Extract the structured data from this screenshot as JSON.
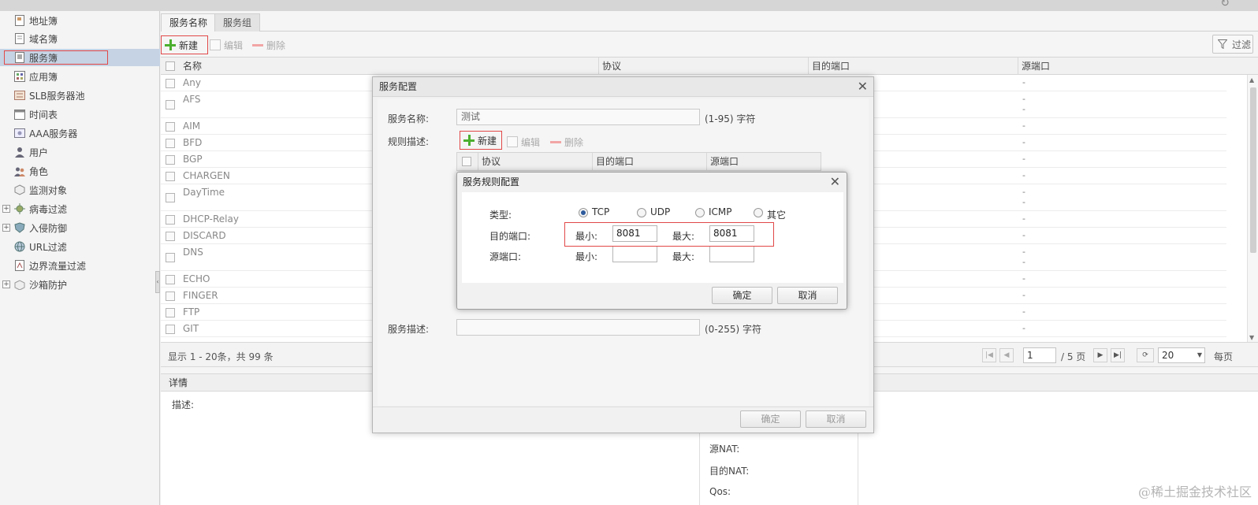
{
  "sidebar": {
    "items": [
      {
        "label": "地址簿",
        "icon": "address-book-icon",
        "expandable": false
      },
      {
        "label": "域名簿",
        "icon": "domain-book-icon",
        "expandable": false
      },
      {
        "label": "服务簿",
        "icon": "service-book-icon",
        "expandable": false,
        "selected": true
      },
      {
        "label": "应用簿",
        "icon": "app-book-icon",
        "expandable": false
      },
      {
        "label": "SLB服务器池",
        "icon": "server-pool-icon",
        "expandable": false
      },
      {
        "label": "时间表",
        "icon": "calendar-icon",
        "expandable": false
      },
      {
        "label": "AAA服务器",
        "icon": "aaa-server-icon",
        "expandable": false
      },
      {
        "label": "用户",
        "icon": "user-icon",
        "expandable": false
      },
      {
        "label": "角色",
        "icon": "role-icon",
        "expandable": false
      },
      {
        "label": "监测对象",
        "icon": "monitor-icon",
        "expandable": false
      },
      {
        "label": "病毒过滤",
        "icon": "virus-filter-icon",
        "expandable": true
      },
      {
        "label": "入侵防御",
        "icon": "shield-icon",
        "expandable": true
      },
      {
        "label": "URL过滤",
        "icon": "globe-icon",
        "expandable": false
      },
      {
        "label": "边界流量过滤",
        "icon": "traffic-filter-icon",
        "expandable": false
      },
      {
        "label": "沙箱防护",
        "icon": "sandbox-icon",
        "expandable": true
      }
    ]
  },
  "tabs": [
    {
      "label": "服务名称",
      "active": true
    },
    {
      "label": "服务组",
      "active": false
    }
  ],
  "toolbar": {
    "new_label": "新建",
    "edit_label": "编辑",
    "delete_label": "删除",
    "filter_label": "过滤"
  },
  "grid": {
    "columns": [
      "名称",
      "协议",
      "目的端口",
      "源端口"
    ],
    "rows": [
      {
        "name": "Any",
        "src": [
          "-"
        ]
      },
      {
        "name": "AFS",
        "src": [
          "-",
          "-"
        ]
      },
      {
        "name": "AIM",
        "src": [
          "-"
        ]
      },
      {
        "name": "BFD",
        "src": [
          "-"
        ]
      },
      {
        "name": "BGP",
        "src": [
          "-"
        ]
      },
      {
        "name": "CHARGEN",
        "src": [
          "-"
        ]
      },
      {
        "name": "DayTime",
        "src": [
          "-",
          "-"
        ]
      },
      {
        "name": "DHCP-Relay",
        "src": [
          "-"
        ]
      },
      {
        "name": "DISCARD",
        "src": [
          "-"
        ]
      },
      {
        "name": "DNS",
        "src": [
          "-",
          "-"
        ]
      },
      {
        "name": "ECHO",
        "src": [
          "-"
        ]
      },
      {
        "name": "FINGER",
        "src": [
          "-"
        ]
      },
      {
        "name": "FTP",
        "src": [
          "-"
        ]
      },
      {
        "name": "GIT",
        "src": [
          "-"
        ]
      }
    ]
  },
  "pager": {
    "info": "显示 1 - 20条，共 99 条",
    "page": "1",
    "total_pages": "/ 5 页",
    "page_size": "20",
    "per_page_label": "每页"
  },
  "detail": {
    "title": "详情",
    "desc_label": "描述:",
    "src_nat_label": "源NAT:",
    "dst_nat_label": "目的NAT:",
    "qos_label": "Qos:"
  },
  "service_dialog": {
    "title": "服务配置",
    "name_label": "服务名称:",
    "name_value": "测试",
    "name_hint": "(1-95) 字符",
    "rule_label": "规则描述:",
    "new_label": "新建",
    "edit_label": "编辑",
    "delete_label": "删除",
    "rule_columns": [
      "协议",
      "目的端口",
      "源端口"
    ],
    "desc_label": "服务描述:",
    "desc_value": "",
    "desc_hint": "(0-255) 字符",
    "ok_label": "确定",
    "cancel_label": "取消"
  },
  "rule_dialog": {
    "title": "服务规则配置",
    "type_label": "类型:",
    "types": [
      {
        "label": "TCP",
        "checked": true
      },
      {
        "label": "UDP",
        "checked": false
      },
      {
        "label": "ICMP",
        "checked": false
      },
      {
        "label": "其它",
        "checked": false
      }
    ],
    "dst_port_label": "目的端口:",
    "src_port_label": "源端口:",
    "min_label": "最小:",
    "max_label": "最大:",
    "dst_min": "8081",
    "dst_max": "8081",
    "src_min": "",
    "src_max": "",
    "ok_label": "确定",
    "cancel_label": "取消"
  },
  "watermark": "@稀土掘金技术社区",
  "colors": {
    "highlight_red": "#e24848",
    "selected_bg": "#c5d3e4",
    "plus_green": "#4caf2f"
  }
}
